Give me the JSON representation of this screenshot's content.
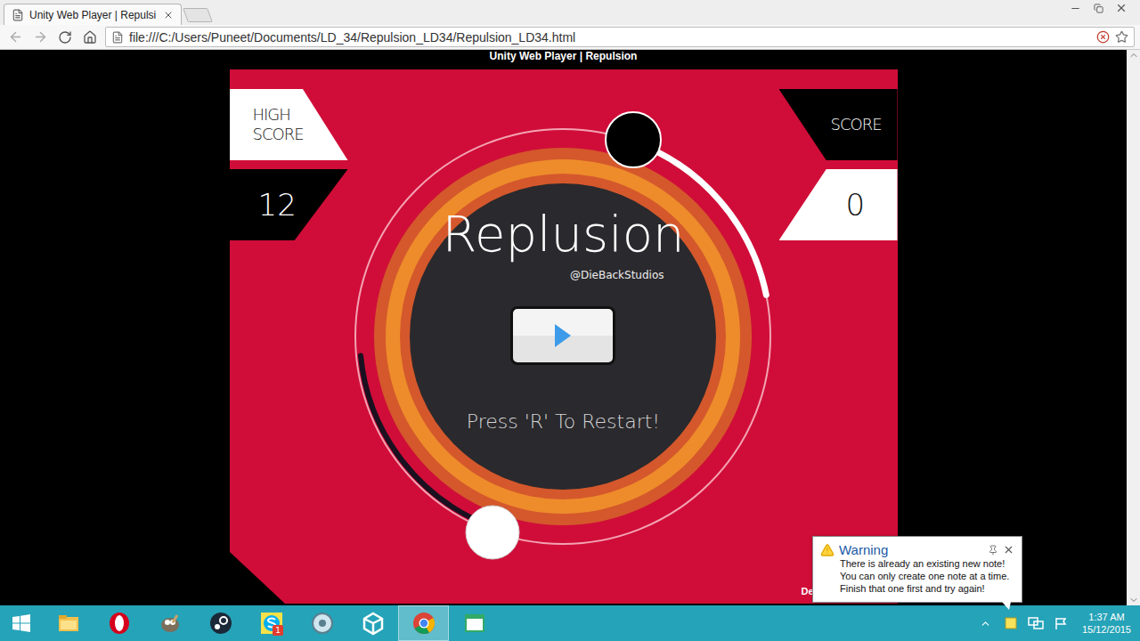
{
  "browser": {
    "tabs": [
      {
        "label": "Unity Web Player | Repulsi",
        "selected": true
      }
    ],
    "address": "file:///C:/Users/Puneet/Documents/LD_34/Repulsion_LD34/Repulsion_LD34.html"
  },
  "page": {
    "header": "Unity Web Player | Repulsion"
  },
  "game": {
    "high_score_label": [
      "HIGH",
      "SCORE"
    ],
    "high_score": "12",
    "score_label": "SCORE",
    "score": "0",
    "title": "Replusion",
    "credit": "@DieBackStudios",
    "restart_hint": "Press 'R' To Restart!",
    "corner_text": "De"
  },
  "notification": {
    "title": "Warning",
    "lines": [
      "There is already an existing new note!",
      "You can only create one note at a time.",
      "Finish that one first and try again!"
    ]
  },
  "taskbar": {
    "apps": [
      {
        "kind": "explorer",
        "active": false,
        "badge": ""
      },
      {
        "kind": "opera",
        "active": false,
        "badge": ""
      },
      {
        "kind": "gimp",
        "active": false,
        "badge": ""
      },
      {
        "kind": "steam",
        "active": false,
        "badge": ""
      },
      {
        "kind": "skype",
        "active": false,
        "badge": "1"
      },
      {
        "kind": "disc",
        "active": false,
        "badge": ""
      },
      {
        "kind": "unity",
        "active": false,
        "badge": ""
      },
      {
        "kind": "chrome",
        "active": true,
        "badge": ""
      },
      {
        "kind": "window",
        "active": false,
        "badge": ""
      }
    ],
    "clock": {
      "time": "1:37 AM",
      "date": "15/12/2015"
    }
  }
}
